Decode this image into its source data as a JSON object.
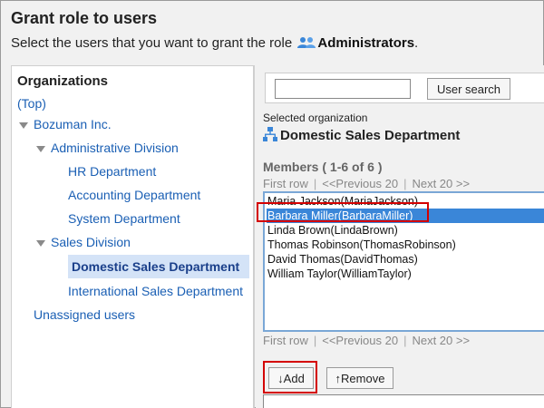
{
  "page": {
    "title": "Grant role to users",
    "subtitle_prefix": "Select the users that you want to grant the role",
    "role_name": "Administrators",
    "subtitle_suffix": "."
  },
  "organizations": {
    "heading": "Organizations",
    "top": "(Top)",
    "company": "Bozuman Inc.",
    "admin_division": "Administrative Division",
    "hr": "HR Department",
    "accounting": "Accounting Department",
    "system": "System Department",
    "sales_division": "Sales Division",
    "domestic_sales": "Domestic Sales Department",
    "international_sales": "International Sales Department",
    "unassigned": "Unassigned users"
  },
  "search": {
    "value": "",
    "button_label": "User search"
  },
  "selected": {
    "label": "Selected organization",
    "org_name": "Domestic Sales Department"
  },
  "members": {
    "heading": "Members ( 1-6 of 6 )",
    "pager": {
      "first": "First row",
      "sep": "|",
      "prev": "<<Previous 20",
      "next": "Next 20 >>"
    },
    "items": [
      "Maria Jackson(MariaJackson)",
      "Barbara Miller(BarbaraMiller)",
      "Linda Brown(LindaBrown)",
      "Thomas Robinson(ThomasRobinson)",
      "David Thomas(DavidThomas)",
      "William Taylor(WilliamTaylor)"
    ],
    "selected_index": 1
  },
  "actions": {
    "add_label": "↓Add",
    "remove_label": "↑Remove"
  },
  "colors": {
    "link": "#1a5fb4",
    "selection": "#3a86d8",
    "highlight": "#d40000"
  }
}
